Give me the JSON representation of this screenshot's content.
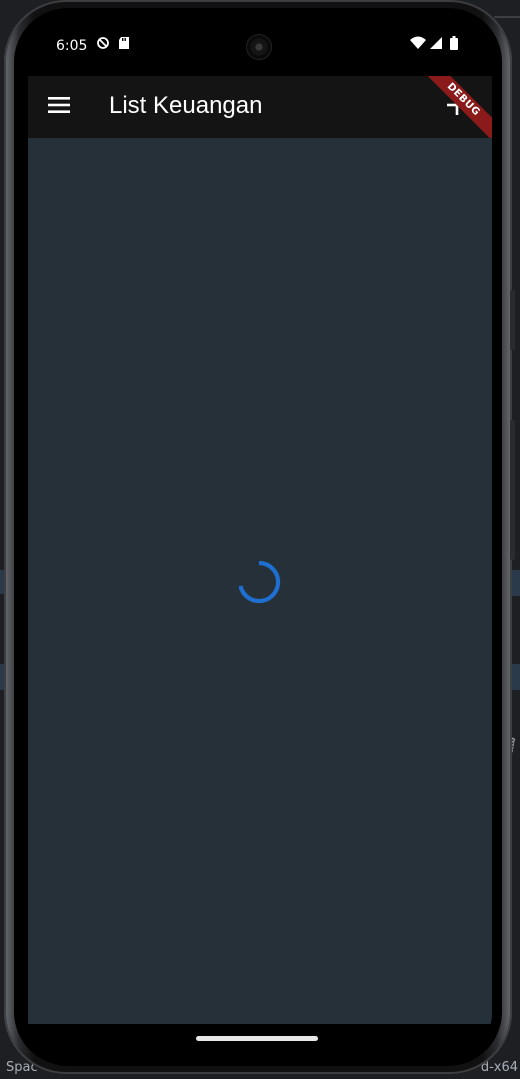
{
  "status_bar": {
    "time": "6:05",
    "icons": [
      "no-sound-icon",
      "sd-card-icon",
      "wifi-icon",
      "signal-icon",
      "battery-icon"
    ]
  },
  "app_bar": {
    "title": "List Keuangan",
    "menu_icon": "hamburger-menu-icon",
    "add_icon": "plus-icon",
    "debug_banner": "DEBUG"
  },
  "content": {
    "state": "loading",
    "spinner_color": "#1e6fd0"
  },
  "background": {
    "bottom_left_text": "Spac",
    "bottom_right_text": "d-x64"
  },
  "colors": {
    "app_bar_bg": "#141414",
    "content_bg": "#263038",
    "debug_banner": "#8b1a1a"
  }
}
